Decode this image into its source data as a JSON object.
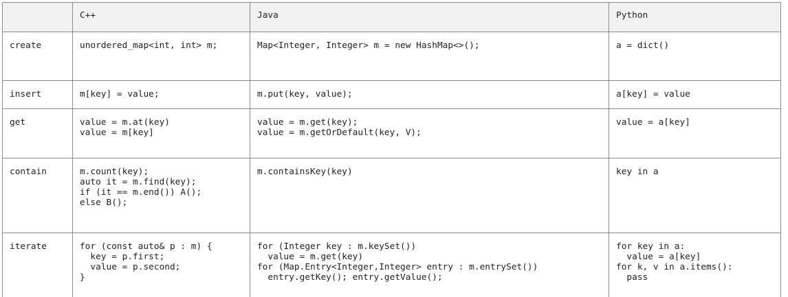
{
  "table": {
    "headers": [
      "",
      "C++",
      "Java",
      "Python"
    ],
    "rows": [
      {
        "op": "create",
        "cpp": "unordered_map<int, int> m;",
        "java": "Map<Integer, Integer> m = new HashMap<>();",
        "python": "a = dict()"
      },
      {
        "op": "insert",
        "cpp": "m[key] = value;",
        "java": "m.put(key, value);",
        "python": "a[key] = value"
      },
      {
        "op": "get",
        "cpp": "value = m.at(key)\nvalue = m[key]",
        "java": "value = m.get(key);\nvalue = m.getOrDefault(key, V);",
        "python": "value = a[key]"
      },
      {
        "op": "contain",
        "cpp": "m.count(key);\nauto it = m.find(key);\nif (it == m.end()) A();\nelse B();",
        "java": "m.containsKey(key)",
        "python": "key in a"
      },
      {
        "op": "iterate",
        "cpp": "for (const auto& p : m) {\n  key = p.first;\n  value = p.second;\n}",
        "java": "for (Integer key : m.keySet())\n  value = m.get(key)\nfor (Map.Entry<Integer,Integer> entry : m.entrySet())\n  entry.getKey(); entry.getValue();",
        "python": "for key in a:\n  value = a[key]\nfor k, v in a.items():\n  pass"
      }
    ]
  }
}
